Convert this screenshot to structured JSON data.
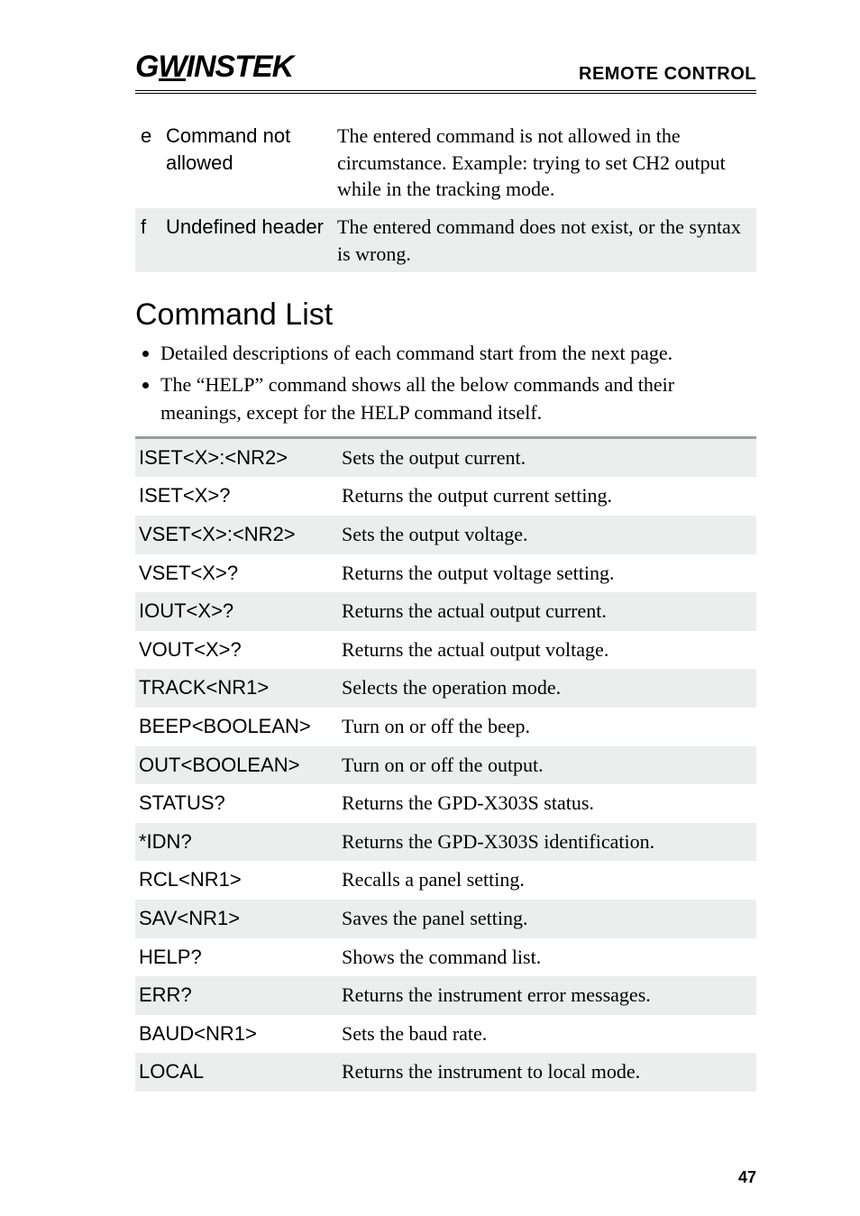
{
  "header": {
    "logo_left": "G",
    "logo_u": "W",
    "logo_right": "INSTEK",
    "title": "REMOTE CONTROL"
  },
  "errors": [
    {
      "code": "e",
      "name": "Command not allowed",
      "desc": "The entered command is not allowed in the circumstance. Example: trying to set CH2 output while in the tracking mode.",
      "shade": false
    },
    {
      "code": "f",
      "name": "Undefined header",
      "desc": "The entered command does not exist, or the syntax is wrong.",
      "shade": true
    }
  ],
  "section_title": "Command List",
  "bullets": [
    "Detailed descriptions of each command start from the next page.",
    "The “HELP” command shows all the below commands and their meanings, except for the HELP command itself."
  ],
  "commands": [
    {
      "name": "ISET<X>:<NR2>",
      "desc": "Sets the output current.",
      "shade": true
    },
    {
      "name": "ISET<X>?",
      "desc": "Returns the output current setting.",
      "shade": false
    },
    {
      "name": "VSET<X>:<NR2>",
      "desc": "Sets the output voltage.",
      "shade": true
    },
    {
      "name": "VSET<X>?",
      "desc": "Returns the output voltage setting.",
      "shade": false
    },
    {
      "name": "IOUT<X>?",
      "desc": "Returns the actual output current.",
      "shade": true
    },
    {
      "name": "VOUT<X>?",
      "desc": "Returns the actual output voltage.",
      "shade": false
    },
    {
      "name": "TRACK<NR1>",
      "desc": "Selects the operation mode.",
      "shade": true
    },
    {
      "name": "BEEP<BOOLEAN>",
      "desc": "Turn on or off the beep.",
      "shade": false
    },
    {
      "name": "OUT<BOOLEAN>",
      "desc": "Turn on or off the output.",
      "shade": true
    },
    {
      "name": "STATUS?",
      "desc": "Returns the GPD-X303S status.",
      "shade": false
    },
    {
      "name": "*IDN?",
      "desc": "Returns the GPD-X303S identification.",
      "shade": true
    },
    {
      "name": "RCL<NR1>",
      "desc": "Recalls a panel setting.",
      "shade": false
    },
    {
      "name": "SAV<NR1>",
      "desc": "Saves the panel setting.",
      "shade": true
    },
    {
      "name": "HELP?",
      "desc": "Shows the command list.",
      "shade": false
    },
    {
      "name": "ERR?",
      "desc": "Returns the instrument error messages.",
      "shade": true
    },
    {
      "name": "BAUD<NR1>",
      "desc": "Sets the baud rate.",
      "shade": false
    },
    {
      "name": "LOCAL",
      "desc": "Returns the instrument to local mode.",
      "shade": true
    }
  ],
  "page_number": "47"
}
